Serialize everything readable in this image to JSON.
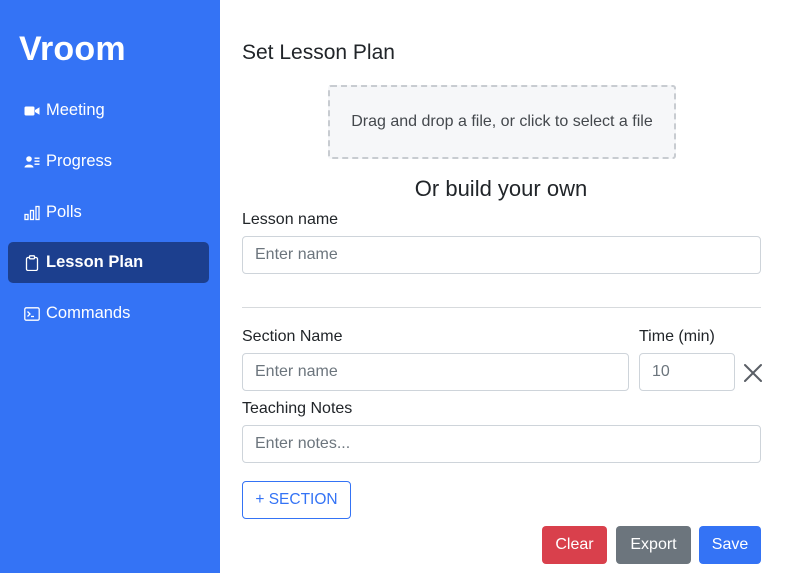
{
  "app": {
    "title": "Vroom"
  },
  "sidebar": {
    "items": [
      {
        "label": "Meeting",
        "icon": "video-camera-icon",
        "active": false
      },
      {
        "label": "Progress",
        "icon": "person-list-icon",
        "active": false
      },
      {
        "label": "Polls",
        "icon": "bar-chart-icon",
        "active": false
      },
      {
        "label": "Lesson Plan",
        "icon": "clipboard-icon",
        "active": true
      },
      {
        "label": "Commands",
        "icon": "terminal-icon",
        "active": false
      }
    ]
  },
  "main": {
    "title": "Set Lesson Plan",
    "dropzone_text": "Drag and drop a file, or click to select a file",
    "subtitle": "Or build your own",
    "lesson_name": {
      "label": "Lesson name",
      "placeholder": "Enter name",
      "value": ""
    },
    "section": {
      "name_label": "Section Name",
      "name_placeholder": "Enter name",
      "time_label": "Time (min)",
      "time_placeholder": "10",
      "notes_label": "Teaching Notes",
      "notes_placeholder": "Enter notes...",
      "remove_icon": "close-icon"
    },
    "buttons": {
      "add_section": "+ SECTION",
      "clear": "Clear",
      "export": "Export",
      "save": "Save"
    }
  },
  "colors": {
    "sidebar": "#3473f5",
    "sidebar_active": "#1c3f8e",
    "clear": "#d9404c",
    "export": "#6c757d",
    "save": "#3473f5"
  }
}
